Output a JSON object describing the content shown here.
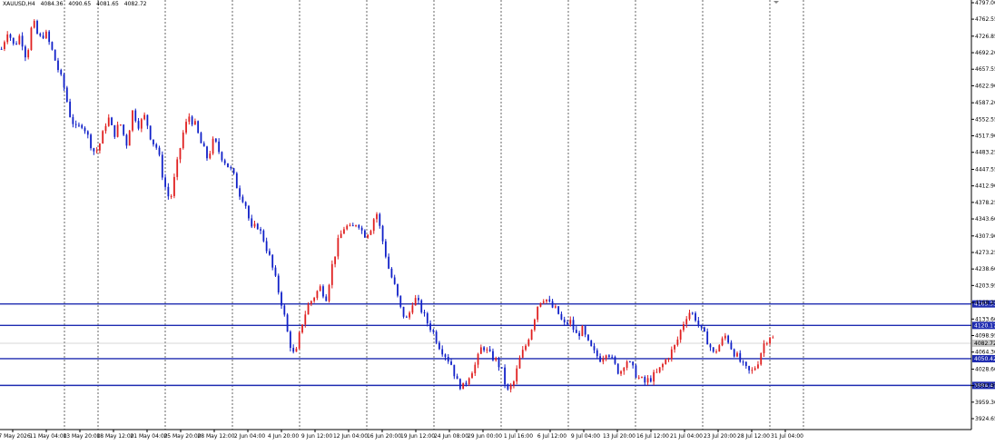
{
  "header": {
    "symbol": "XAUUSD,H4",
    "open": "4084.36",
    "high": "4090.65",
    "low": "4081.65",
    "close": "4082.72"
  },
  "colors": {
    "up": "#e02020",
    "down": "#1020c8",
    "level_line": "#1e2bb0",
    "level_label_bg": "#1e2bb0",
    "grid": "#000000",
    "price_label_bg": "#c8c8c8"
  },
  "chart_data": {
    "type": "candlestick",
    "timeframe": "H4",
    "ylim": [
      3924.65,
      4797.0
    ],
    "y_ticks": [
      "4797.00",
      "4762.55",
      "4726.85",
      "4692.20",
      "4657.55",
      "4622.90",
      "4587.20",
      "4552.55",
      "4517.90",
      "4483.25",
      "4447.55",
      "4412.90",
      "4378.25",
      "4343.60",
      "4307.90",
      "4273.25",
      "4238.60",
      "4203.95",
      "4168.25",
      "4133.60",
      "4098.95",
      "4064.30",
      "4028.60",
      "3993.95",
      "3959.30",
      "3924.65"
    ],
    "x_labels": [
      "7 May 2026",
      "11 May 04:00",
      "13 May 20:00",
      "18 May 12:00",
      "21 May 04:00",
      "25 May 20:00",
      "28 May 12:00",
      "2 Jun 04:00",
      "4 Jun 20:00",
      "9 Jun 12:00",
      "12 Jun 04:00",
      "16 Jun 20:00",
      "19 Jun 12:00",
      "24 Jun 08:00",
      "29 Jun 00:00",
      "1 Jul 16:00",
      "6 Jul 12:00",
      "9 Jul 04:00",
      "13 Jul 20:00",
      "16 Jul 12:00",
      "21 Jul 04:00",
      "23 Jul 20:00",
      "28 Jul 12:00",
      "31 Jul 04:00"
    ],
    "vertical_grid_at": [
      "11 May 04:00",
      "13 May 20:00",
      "21 May 04:00",
      "28 May 12:00",
      "4 Jun 20:00",
      "12 Jun 04:00",
      "19 Jun 12:00",
      "29 Jun 00:00",
      "6 Jul 12:00",
      "13 Jul 20:00",
      "21 Jul 04:00",
      "28 Jul 12:00",
      "31 Jul 04:00"
    ],
    "levels": [
      {
        "price": 4165.33,
        "label": "4165.33"
      },
      {
        "price": 4120.17,
        "label": "4120.17"
      },
      {
        "price": 4050.42,
        "label": "4050.42"
      },
      {
        "price": 3994.41,
        "label": "3994.41"
      }
    ],
    "current_price": {
      "price": 4082.72,
      "label": "4082.72"
    },
    "path": [
      4700,
      4740,
      4705,
      4730,
      4680,
      4760,
      4720,
      4735,
      4700,
      4660,
      4620,
      4560,
      4530,
      4545,
      4510,
      4480,
      4510,
      4560,
      4520,
      4545,
      4500,
      4570,
      4540,
      4560,
      4510,
      4490,
      4420,
      4380,
      4450,
      4520,
      4560,
      4540,
      4500,
      4470,
      4510,
      4480,
      4460,
      4440,
      4400,
      4380,
      4320,
      4330,
      4300,
      4260,
      4210,
      4160,
      4090,
      4050,
      4120,
      4160,
      4180,
      4200,
      4180,
      4250,
      4300,
      4330,
      4320,
      4340,
      4310,
      4320,
      4360,
      4300,
      4240,
      4200,
      4150,
      4130,
      4180,
      4160,
      4130,
      4110,
      4080,
      4060,
      4040,
      4000,
      3990,
      4020,
      4040,
      4080,
      4060,
      4050,
      4030,
      3980,
      4000,
      4050,
      4080,
      4120,
      4170,
      4180,
      4160,
      4150,
      4120,
      4130,
      4100,
      4110,
      4080,
      4060,
      4050,
      4070,
      4040,
      4020,
      4050,
      4030,
      4010,
      4000,
      4010,
      4020,
      4040,
      4060,
      4080,
      4120,
      4150,
      4140,
      4110,
      4090,
      4060,
      4080,
      4100,
      4070,
      4050,
      4030,
      4020,
      4040,
      4080,
      4100,
      4085
    ]
  }
}
